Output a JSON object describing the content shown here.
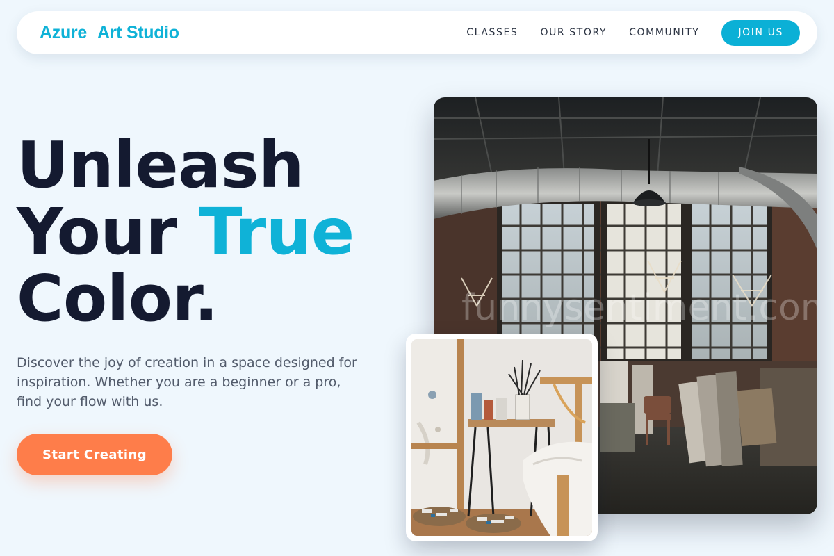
{
  "nav": {
    "logo_word1": "Azure",
    "logo_word2": "Art Studio",
    "links": [
      "CLASSES",
      "OUR STORY",
      "COMMUNITY"
    ],
    "cta_label": "JOIN US"
  },
  "hero": {
    "headline_line1": "Unleash",
    "headline_line2a": "Your",
    "headline_line2b": "True",
    "headline_line3": "Color.",
    "lede": "Discover the joy of creation in a space designed for inspiration. Whether you are a beginner or a pro, find your flow with us.",
    "cta_label": "Start Creating"
  },
  "images": {
    "main_watermark": "funnysentiment.com"
  },
  "colors": {
    "accent": "#0fb2d7",
    "headline": "#141a30",
    "cta": "#fe7d4a",
    "background": "#eff7fd"
  }
}
